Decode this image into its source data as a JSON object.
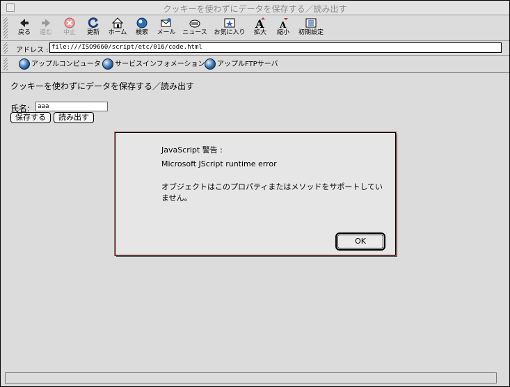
{
  "window": {
    "title": "クッキーを使わずにデータを保存する／読み出す"
  },
  "toolbar": {
    "buttons": [
      {
        "label": "戻る",
        "icon": "back-arrow-icon"
      },
      {
        "label": "進む",
        "icon": "forward-arrow-icon"
      },
      {
        "label": "中止",
        "icon": "stop-icon"
      },
      {
        "label": "更新",
        "icon": "refresh-icon"
      },
      {
        "label": "ホーム",
        "icon": "home-icon"
      },
      {
        "label": "検索",
        "icon": "search-globe-icon"
      },
      {
        "label": "メール",
        "icon": "mail-icon"
      },
      {
        "label": "ニュース",
        "icon": "news-icon"
      },
      {
        "label": "お気に入り",
        "icon": "favorites-icon"
      },
      {
        "label": "拡大",
        "icon": "text-larger-icon"
      },
      {
        "label": "縮小",
        "icon": "text-smaller-icon"
      },
      {
        "label": "初期設定",
        "icon": "preferences-icon"
      }
    ]
  },
  "address": {
    "label": "アドレス :",
    "value": "file:///ISO9660/script/etc/016/code.html"
  },
  "links": [
    {
      "label": "アップルコンピュータ"
    },
    {
      "label": "サービスインフォメーション"
    },
    {
      "label": "アップルFTPサーバ"
    }
  ],
  "page": {
    "heading": "クッキーを使わずにデータを保存する／読み出す",
    "name_label": "氏名:",
    "name_value": "aaa",
    "save_button": "保存する",
    "load_button": "読み出す"
  },
  "dialog": {
    "title": "JavaScript 警告 :",
    "error": "Microsoft JScript runtime error",
    "message": "オブジェクトはこのプロパティまたはメソッドをサポートしていません。",
    "ok_label": "OK"
  },
  "colors": {
    "disabled_text": "#9a9a9a",
    "window_bg": "#dcdcdc",
    "dialog_border_accent": "#b06060"
  }
}
